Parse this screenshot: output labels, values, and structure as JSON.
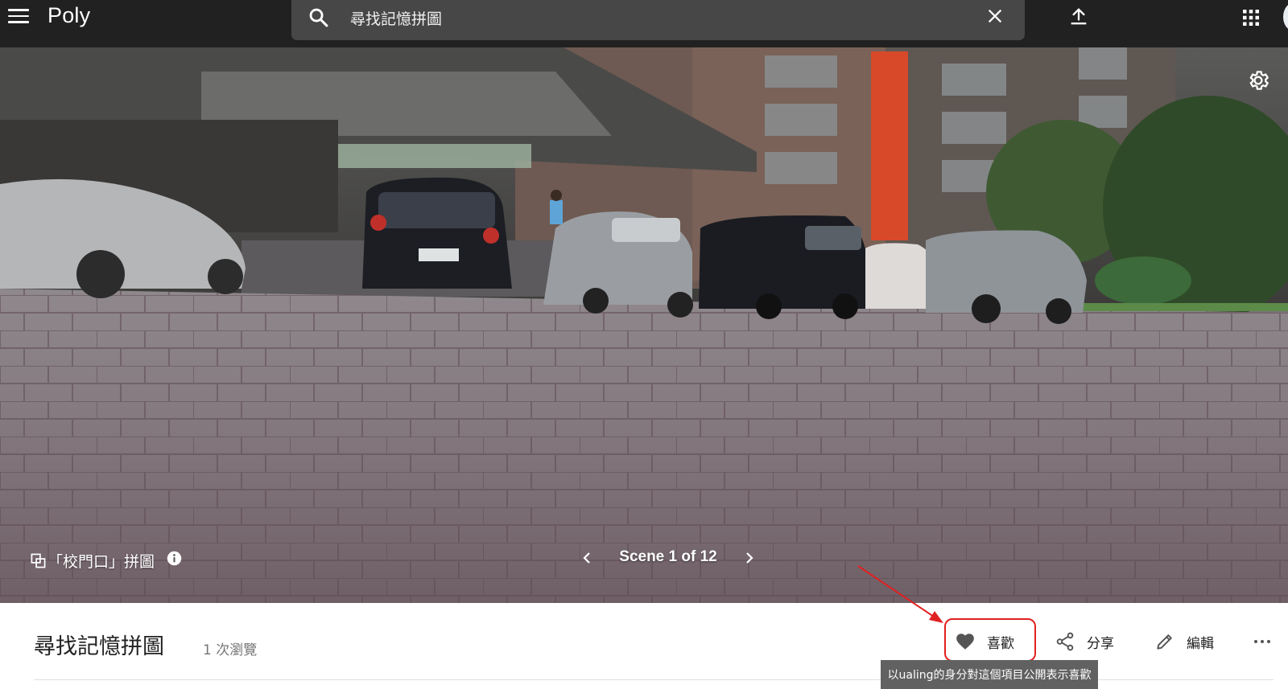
{
  "app": {
    "logo": "Poly"
  },
  "search": {
    "value": "尋找記憶拼圖"
  },
  "viewer": {
    "scene_title": "「校門口」拼圖",
    "scene_counter": "Scene 1 of 12",
    "current_scene": 1,
    "total_scenes": 12
  },
  "info": {
    "title": "尋找記憶拼圖",
    "views": "1 次瀏覽"
  },
  "actions": {
    "like": "喜歡",
    "share": "分享",
    "edit": "編輯"
  },
  "tooltip": {
    "text": "以ualing的身分對這個項目公開表示喜歡"
  },
  "colors": {
    "topbar": "#212121",
    "search_bg": "#474747",
    "annotation": "#e02020",
    "tooltip_bg": "#616161"
  }
}
